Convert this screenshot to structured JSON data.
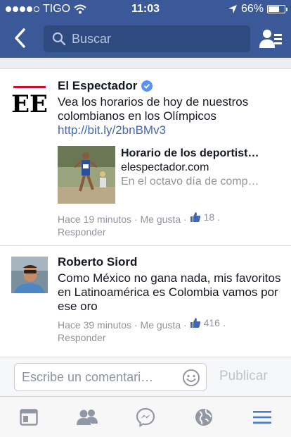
{
  "status_bar": {
    "carrier": "TIGO",
    "time": "11:03",
    "battery": "66%",
    "battery_level": 0.66
  },
  "nav": {
    "search_placeholder": "Buscar"
  },
  "comments": [
    {
      "author": "El Espectador",
      "verified": true,
      "text": "Vea los horarios de hoy de nuestros colombianos en los Olímpicos ",
      "link": "http://bit.ly/2bnBMv3",
      "attachment": {
        "title": "Horario de los deportist…",
        "domain": "elespectador.com",
        "description": "En el octavo día de comp…"
      },
      "time": "Hace 19 minutos",
      "like_label": "Me gusta",
      "like_count": "18",
      "reply_label": "Responder"
    },
    {
      "author": "Roberto Siord",
      "verified": false,
      "text": "Como México no gana nada, mis favoritos en Latinoamérica es Colombia vamos por ese oro",
      "time": "Hace 39 minutos",
      "like_label": "Me gusta",
      "like_count": "416",
      "reply_label": "Responder"
    }
  ],
  "composer": {
    "placeholder": "Escribe un comentari…",
    "publish_label": "Publicar"
  },
  "colors": {
    "brand": "#3b5998",
    "link": "#4267b2",
    "active_tab": "#4a7ac9",
    "inactive_tab": "#9197a3"
  },
  "tabs": [
    "news-feed-icon",
    "friends-icon",
    "messenger-icon",
    "globe-icon",
    "menu-icon"
  ]
}
